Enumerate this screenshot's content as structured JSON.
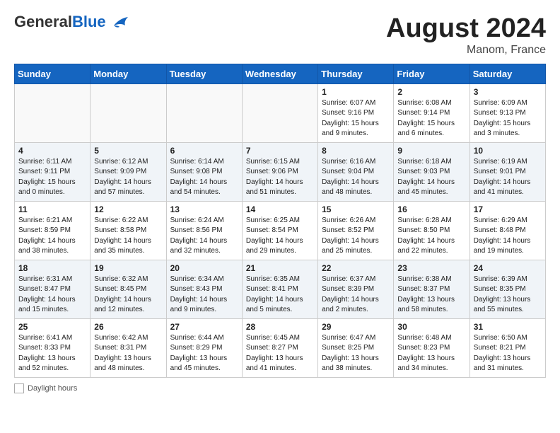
{
  "header": {
    "logo_general": "General",
    "logo_blue": "Blue",
    "month_title": "August 2024",
    "location": "Manom, France"
  },
  "days_of_week": [
    "Sunday",
    "Monday",
    "Tuesday",
    "Wednesday",
    "Thursday",
    "Friday",
    "Saturday"
  ],
  "weeks": [
    [
      {
        "day": "",
        "info": ""
      },
      {
        "day": "",
        "info": ""
      },
      {
        "day": "",
        "info": ""
      },
      {
        "day": "",
        "info": ""
      },
      {
        "day": "1",
        "info": "Sunrise: 6:07 AM\nSunset: 9:16 PM\nDaylight: 15 hours\nand 9 minutes."
      },
      {
        "day": "2",
        "info": "Sunrise: 6:08 AM\nSunset: 9:14 PM\nDaylight: 15 hours\nand 6 minutes."
      },
      {
        "day": "3",
        "info": "Sunrise: 6:09 AM\nSunset: 9:13 PM\nDaylight: 15 hours\nand 3 minutes."
      }
    ],
    [
      {
        "day": "4",
        "info": "Sunrise: 6:11 AM\nSunset: 9:11 PM\nDaylight: 15 hours\nand 0 minutes."
      },
      {
        "day": "5",
        "info": "Sunrise: 6:12 AM\nSunset: 9:09 PM\nDaylight: 14 hours\nand 57 minutes."
      },
      {
        "day": "6",
        "info": "Sunrise: 6:14 AM\nSunset: 9:08 PM\nDaylight: 14 hours\nand 54 minutes."
      },
      {
        "day": "7",
        "info": "Sunrise: 6:15 AM\nSunset: 9:06 PM\nDaylight: 14 hours\nand 51 minutes."
      },
      {
        "day": "8",
        "info": "Sunrise: 6:16 AM\nSunset: 9:04 PM\nDaylight: 14 hours\nand 48 minutes."
      },
      {
        "day": "9",
        "info": "Sunrise: 6:18 AM\nSunset: 9:03 PM\nDaylight: 14 hours\nand 45 minutes."
      },
      {
        "day": "10",
        "info": "Sunrise: 6:19 AM\nSunset: 9:01 PM\nDaylight: 14 hours\nand 41 minutes."
      }
    ],
    [
      {
        "day": "11",
        "info": "Sunrise: 6:21 AM\nSunset: 8:59 PM\nDaylight: 14 hours\nand 38 minutes."
      },
      {
        "day": "12",
        "info": "Sunrise: 6:22 AM\nSunset: 8:58 PM\nDaylight: 14 hours\nand 35 minutes."
      },
      {
        "day": "13",
        "info": "Sunrise: 6:24 AM\nSunset: 8:56 PM\nDaylight: 14 hours\nand 32 minutes."
      },
      {
        "day": "14",
        "info": "Sunrise: 6:25 AM\nSunset: 8:54 PM\nDaylight: 14 hours\nand 29 minutes."
      },
      {
        "day": "15",
        "info": "Sunrise: 6:26 AM\nSunset: 8:52 PM\nDaylight: 14 hours\nand 25 minutes."
      },
      {
        "day": "16",
        "info": "Sunrise: 6:28 AM\nSunset: 8:50 PM\nDaylight: 14 hours\nand 22 minutes."
      },
      {
        "day": "17",
        "info": "Sunrise: 6:29 AM\nSunset: 8:48 PM\nDaylight: 14 hours\nand 19 minutes."
      }
    ],
    [
      {
        "day": "18",
        "info": "Sunrise: 6:31 AM\nSunset: 8:47 PM\nDaylight: 14 hours\nand 15 minutes."
      },
      {
        "day": "19",
        "info": "Sunrise: 6:32 AM\nSunset: 8:45 PM\nDaylight: 14 hours\nand 12 minutes."
      },
      {
        "day": "20",
        "info": "Sunrise: 6:34 AM\nSunset: 8:43 PM\nDaylight: 14 hours\nand 9 minutes."
      },
      {
        "day": "21",
        "info": "Sunrise: 6:35 AM\nSunset: 8:41 PM\nDaylight: 14 hours\nand 5 minutes."
      },
      {
        "day": "22",
        "info": "Sunrise: 6:37 AM\nSunset: 8:39 PM\nDaylight: 14 hours\nand 2 minutes."
      },
      {
        "day": "23",
        "info": "Sunrise: 6:38 AM\nSunset: 8:37 PM\nDaylight: 13 hours\nand 58 minutes."
      },
      {
        "day": "24",
        "info": "Sunrise: 6:39 AM\nSunset: 8:35 PM\nDaylight: 13 hours\nand 55 minutes."
      }
    ],
    [
      {
        "day": "25",
        "info": "Sunrise: 6:41 AM\nSunset: 8:33 PM\nDaylight: 13 hours\nand 52 minutes."
      },
      {
        "day": "26",
        "info": "Sunrise: 6:42 AM\nSunset: 8:31 PM\nDaylight: 13 hours\nand 48 minutes."
      },
      {
        "day": "27",
        "info": "Sunrise: 6:44 AM\nSunset: 8:29 PM\nDaylight: 13 hours\nand 45 minutes."
      },
      {
        "day": "28",
        "info": "Sunrise: 6:45 AM\nSunset: 8:27 PM\nDaylight: 13 hours\nand 41 minutes."
      },
      {
        "day": "29",
        "info": "Sunrise: 6:47 AM\nSunset: 8:25 PM\nDaylight: 13 hours\nand 38 minutes."
      },
      {
        "day": "30",
        "info": "Sunrise: 6:48 AM\nSunset: 8:23 PM\nDaylight: 13 hours\nand 34 minutes."
      },
      {
        "day": "31",
        "info": "Sunrise: 6:50 AM\nSunset: 8:21 PM\nDaylight: 13 hours\nand 31 minutes."
      }
    ]
  ],
  "footer": {
    "daylight_label": "Daylight hours"
  }
}
